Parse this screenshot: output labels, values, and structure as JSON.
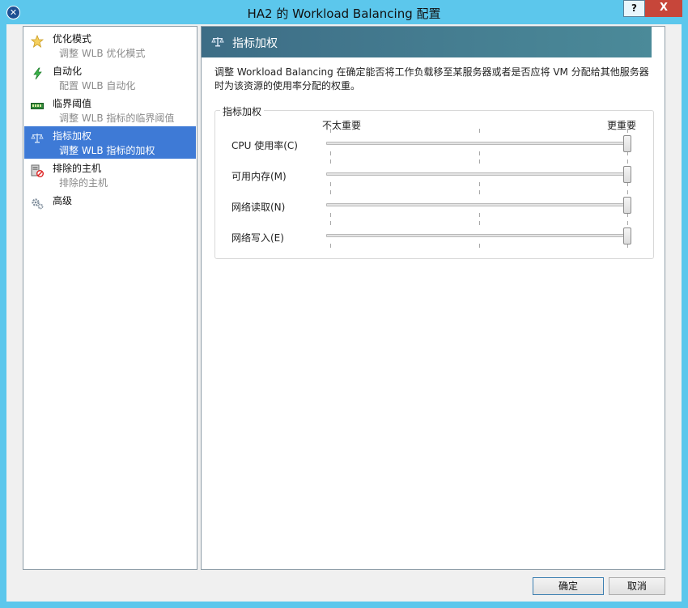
{
  "window": {
    "title": "HA2 的 Workload Balancing 配置",
    "help_label": "?",
    "close_label": "X"
  },
  "sidebar": {
    "items": [
      {
        "title": "优化模式",
        "subtitle": "调整 WLB 优化模式",
        "icon": "star-icon",
        "active": false
      },
      {
        "title": "自动化",
        "subtitle": "配置 WLB 自动化",
        "icon": "lightning-icon",
        "active": false
      },
      {
        "title": "临界阈值",
        "subtitle": "调整 WLB 指标的临界阈值",
        "icon": "memory-icon",
        "active": false
      },
      {
        "title": "指标加权",
        "subtitle": "调整 WLB 指标的加权",
        "icon": "weights-icon",
        "active": true
      },
      {
        "title": "排除的主机",
        "subtitle": "排除的主机",
        "icon": "excluded-host-icon",
        "active": false
      },
      {
        "title": "高级",
        "subtitle": "",
        "icon": "gears-icon",
        "active": false
      }
    ]
  },
  "content": {
    "header_title": "指标加权",
    "description": "调整 Workload Balancing 在确定能否将工作负载移至某服务器或者是否应将 VM 分配给其他服务器时为该资源的使用率分配的权重。",
    "group_title": "指标加权",
    "scale_low": "不太重要",
    "scale_high": "更重要",
    "sliders": [
      {
        "label": "CPU 使用率(C)",
        "value": 1.0
      },
      {
        "label": "可用内存(M)",
        "value": 1.0
      },
      {
        "label": "网络读取(N)",
        "value": 1.0
      },
      {
        "label": "网络写入(E)",
        "value": 1.0
      }
    ]
  },
  "footer": {
    "ok_label": "确定",
    "cancel_label": "取消"
  },
  "colors": {
    "titlebar": "#5cc7ec",
    "selection": "#3e7ad6",
    "header_gradient_start": "#3d6d86",
    "header_gradient_end": "#4b8a99"
  }
}
